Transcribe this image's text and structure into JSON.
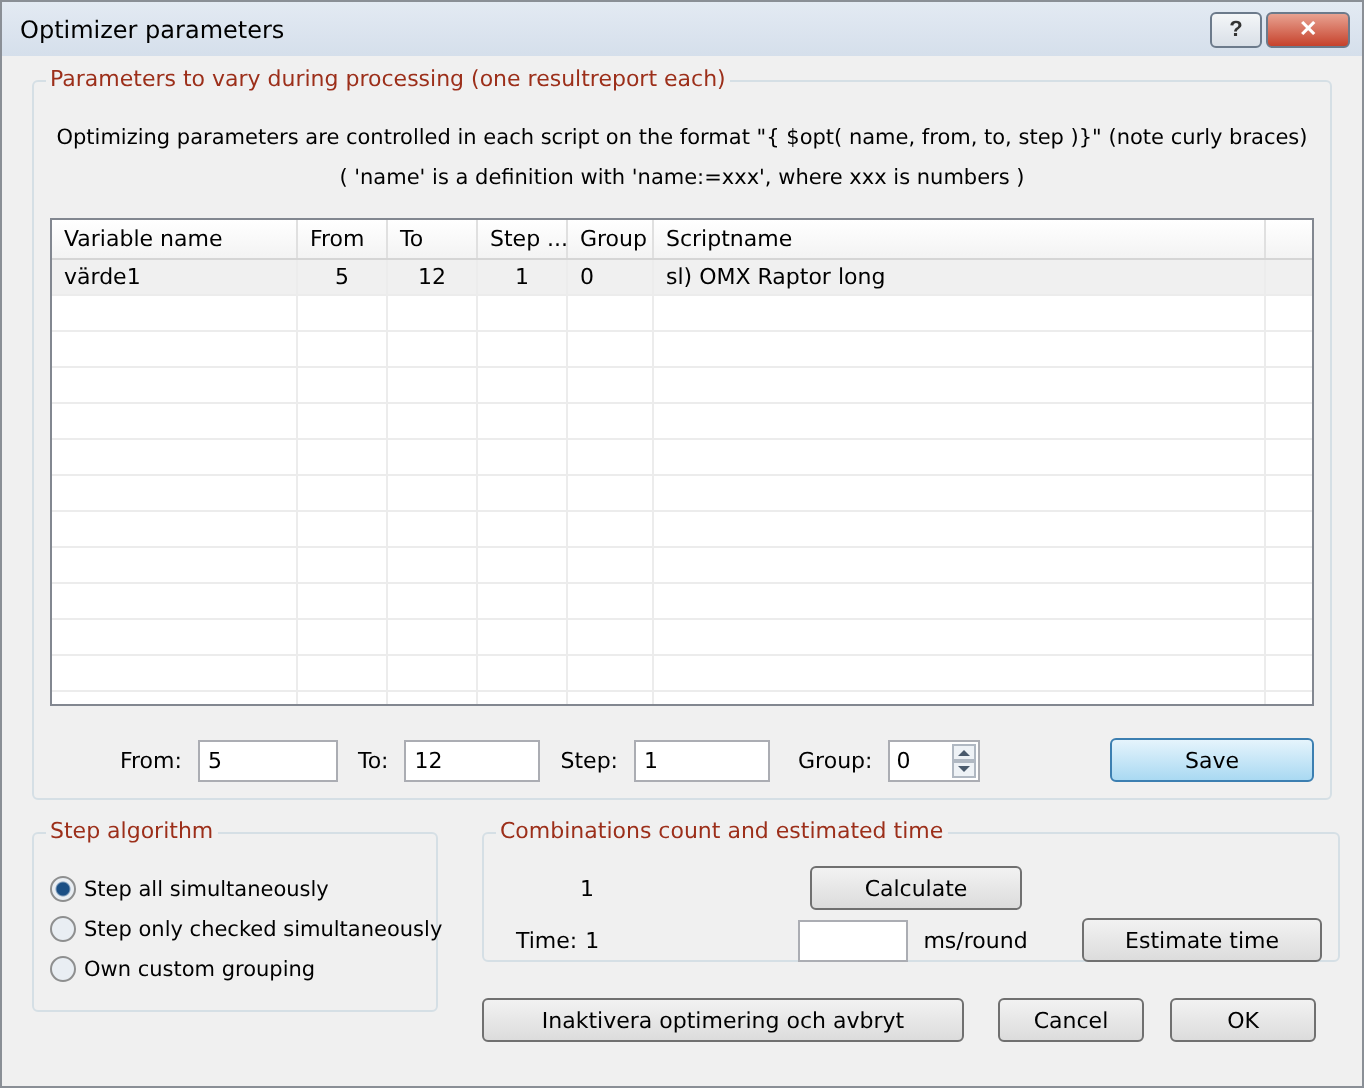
{
  "window": {
    "title": "Optimizer parameters",
    "buttons": [
      {
        "kind": "help",
        "label": "?"
      },
      {
        "kind": "close",
        "label": "✕"
      }
    ]
  },
  "parameters_group": {
    "title": "Parameters to vary during processing (one resultreport each)",
    "note_1": "Optimizing parameters are controlled in each script on the format \"{ $opt( name, from, to, step )}\" (note curly braces)",
    "note_2": "( 'name' is a definition with 'name:=xxx', where xxx is numbers )"
  },
  "table": {
    "columns": [
      "Variable name",
      "From",
      "To",
      "Step ...",
      "Group",
      "Scriptname"
    ],
    "rows": [
      {
        "selected": true,
        "cells": [
          "värde1",
          "5",
          "12",
          "1",
          "0",
          "sl) OMX Raptor long"
        ]
      }
    ]
  },
  "editor": {
    "fields": [
      {
        "label": "From:",
        "value": "5"
      },
      {
        "label": "To:",
        "value": "12"
      },
      {
        "label": "Step:",
        "value": "1"
      }
    ],
    "group": {
      "label": "Group:",
      "value": "0"
    },
    "save_button": "Save"
  },
  "step_algorithm": {
    "title": "Step algorithm",
    "options": [
      {
        "label": "Step all simultaneously",
        "selected": true
      },
      {
        "label": "Step only checked simultaneously",
        "selected": false
      },
      {
        "label": "Own custom grouping",
        "selected": false
      }
    ]
  },
  "combinations": {
    "title": "Combinations count and estimated time",
    "count": "1",
    "calculate_button": "Calculate",
    "time_label": "Time:",
    "time_value": "1",
    "unit": "ms/round",
    "estimate_button": "Estimate time"
  },
  "buttons": [
    "Inaktivera optimering och avbryt",
    "Cancel",
    "OK"
  ]
}
